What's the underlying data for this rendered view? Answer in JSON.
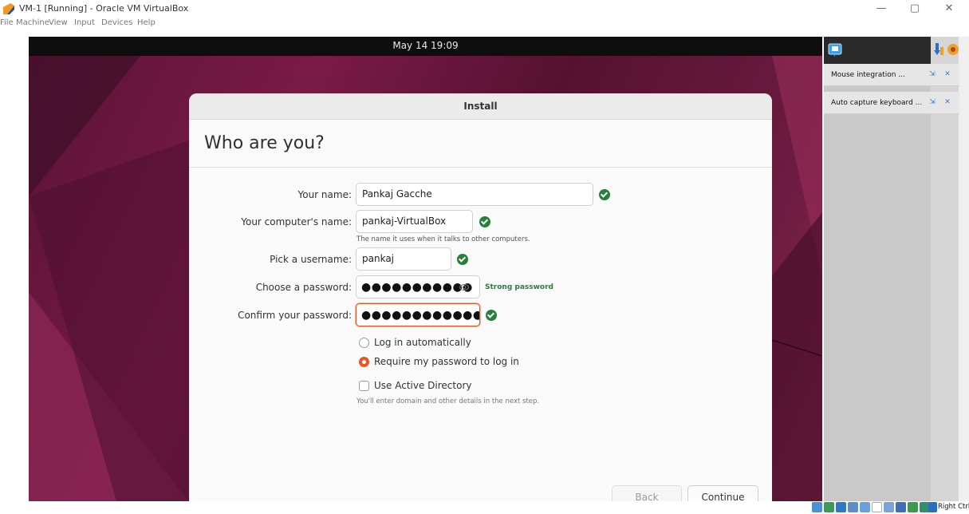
{
  "window": {
    "title": "VM-1 [Running] - Oracle VM VirtualBox",
    "minimize": "—",
    "maximize": "▢",
    "close": "✕"
  },
  "menu": [
    "File",
    "Machine",
    "View",
    "Input",
    "Devices",
    "Help"
  ],
  "guest": {
    "clock": "May 14  19:09"
  },
  "installer": {
    "title": "Install",
    "heading": "Who are you?",
    "your_name_label": "Your name:",
    "your_name_value": "Pankaj Gacche",
    "computer_name_label": "Your computer's name:",
    "computer_name_value": "pankaj-VirtualBox",
    "computer_name_hint": "The name it uses when it talks to other computers.",
    "username_label": "Pick a username:",
    "username_value": "pankaj",
    "password_label": "Choose a password:",
    "password_value": "●●●●●●●●●●●",
    "password_strength": "Strong password",
    "confirm_label": "Confirm your password:",
    "confirm_value": "●●●●●●●●●●●●●",
    "login_auto": "Log in automatically",
    "login_require": "Require my password to log in",
    "login_selected": "require",
    "active_directory": "Use Active Directory",
    "active_directory_checked": false,
    "active_directory_hint": "You'll enter domain and other details in the next step.",
    "back": "Back",
    "continue": "Continue"
  },
  "vbox_notifications": [
    "Mouse integration ...",
    "Auto capture keyboard ..."
  ],
  "statusbar": {
    "host_key": "Right Ctrl"
  },
  "colors": {
    "accent": "#e95420",
    "ok": "#26803a",
    "wallpaper": "#6a1b3f"
  }
}
